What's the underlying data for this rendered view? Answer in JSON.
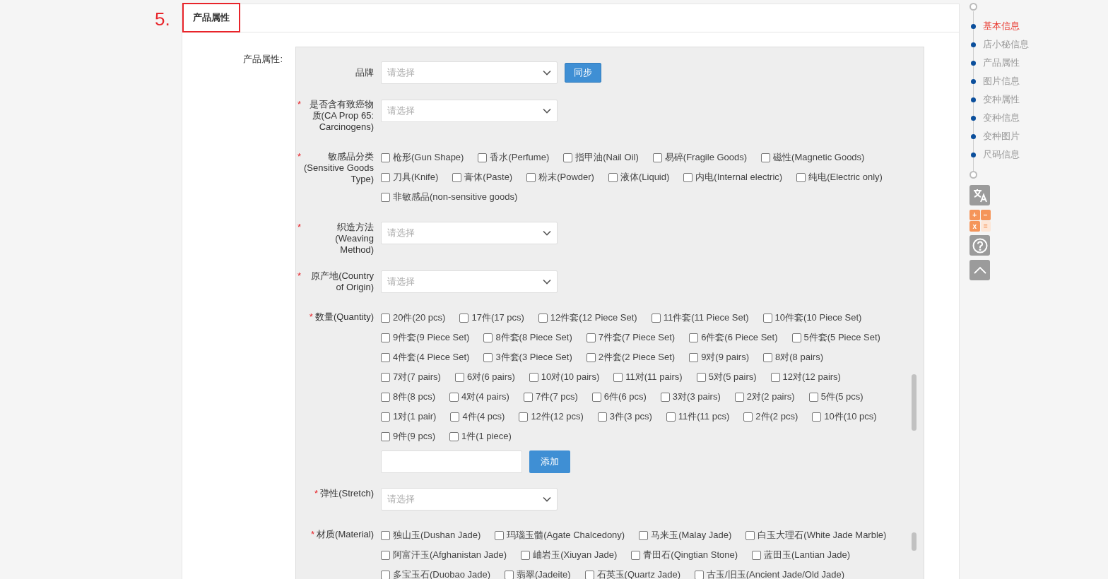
{
  "step_number": "5.",
  "section_tab": {
    "label": "产品属性",
    "selected": true
  },
  "attributes_label": "产品属性:",
  "fields": [
    {
      "kind": "select",
      "label": "品牌",
      "placeholder": "请选择",
      "button": "同步"
    },
    {
      "kind": "select",
      "label": "是否含有致癌物质(CA Prop 65: Carcinogens)",
      "required_mark": "*",
      "placeholder": "请选择"
    },
    {
      "kind": "checkboxes",
      "label": "敏感品分类(Sensitive Goods Type)",
      "required_mark": "*",
      "scrollbar": false,
      "options": [
        {
          "label": "枪形(Gun Shape)",
          "checked": false
        },
        {
          "label": "香水(Perfume)",
          "checked": false
        },
        {
          "label": "指甲油(Nail Oil)",
          "checked": false
        },
        {
          "label": "易碎(Fragile Goods)",
          "checked": false
        },
        {
          "label": "磁性(Magnetic Goods)",
          "checked": false
        },
        {
          "label": "刀具(Knife)",
          "checked": false
        },
        {
          "label": "膏体(Paste)",
          "checked": false
        },
        {
          "label": "粉末(Powder)",
          "checked": false
        },
        {
          "label": "液体(Liquid)",
          "checked": false
        },
        {
          "label": "内电(Internal electric)",
          "checked": false
        },
        {
          "label": "纯电(Electric only)",
          "checked": false
        },
        {
          "label": "非敏感品(non-sensitive goods)",
          "checked": false
        }
      ]
    },
    {
      "kind": "select",
      "label": "织造方法(Weaving Method)",
      "required_mark": "*",
      "placeholder": "请选择"
    },
    {
      "kind": "select",
      "label": "原产地(Country of Origin)",
      "required_mark": "*",
      "placeholder": "请选择"
    },
    {
      "kind": "checkboxes",
      "label": "数量(Quantity)",
      "required_mark": "*",
      "scrollbar": true,
      "add_button": "添加",
      "options": [
        {
          "label": "20件(20 pcs)",
          "checked": false
        },
        {
          "label": "17件(17 pcs)",
          "checked": false
        },
        {
          "label": "12件套(12 Piece Set)",
          "checked": false
        },
        {
          "label": "11件套(11 Piece Set)",
          "checked": false
        },
        {
          "label": "10件套(10 Piece Set)",
          "checked": false
        },
        {
          "label": "9件套(9 Piece Set)",
          "checked": false
        },
        {
          "label": "8件套(8 Piece Set)",
          "checked": false
        },
        {
          "label": "7件套(7 Piece Set)",
          "checked": false
        },
        {
          "label": "6件套(6 Piece Set)",
          "checked": false
        },
        {
          "label": "5件套(5 Piece Set)",
          "checked": false
        },
        {
          "label": "4件套(4 Piece Set)",
          "checked": false
        },
        {
          "label": "3件套(3 Piece Set)",
          "checked": false
        },
        {
          "label": "2件套(2 Piece Set)",
          "checked": false
        },
        {
          "label": "9对(9 pairs)",
          "checked": false
        },
        {
          "label": "8对(8 pairs)",
          "checked": false
        },
        {
          "label": "7对(7 pairs)",
          "checked": false
        },
        {
          "label": "6对(6 pairs)",
          "checked": false
        },
        {
          "label": "10对(10 pairs)",
          "checked": false
        },
        {
          "label": "11对(11 pairs)",
          "checked": false
        },
        {
          "label": "5对(5 pairs)",
          "checked": false
        },
        {
          "label": "12对(12 pairs)",
          "checked": false
        },
        {
          "label": "8件(8 pcs)",
          "checked": false
        },
        {
          "label": "4对(4 pairs)",
          "checked": false
        },
        {
          "label": "7件(7 pcs)",
          "checked": false
        },
        {
          "label": "6件(6 pcs)",
          "checked": false
        },
        {
          "label": "3对(3 pairs)",
          "checked": false
        },
        {
          "label": "2对(2 pairs)",
          "checked": false
        },
        {
          "label": "5件(5 pcs)",
          "checked": false
        },
        {
          "label": "1对(1 pair)",
          "checked": false
        },
        {
          "label": "4件(4 pcs)",
          "checked": false
        },
        {
          "label": "12件(12 pcs)",
          "checked": false
        },
        {
          "label": "3件(3 pcs)",
          "checked": false
        },
        {
          "label": "11件(11 pcs)",
          "checked": false
        },
        {
          "label": "2件(2 pcs)",
          "checked": false
        },
        {
          "label": "10件(10 pcs)",
          "checked": false
        },
        {
          "label": "9件(9 pcs)",
          "checked": false
        },
        {
          "label": "1件(1 piece)",
          "checked": false
        }
      ]
    },
    {
      "kind": "select",
      "label": "弹性(Stretch)",
      "required_mark": "*",
      "placeholder": "请选择"
    },
    {
      "kind": "checkboxes",
      "label": "材质(Material)",
      "required_mark": "*",
      "scrollbar": true,
      "options": [
        {
          "label": "独山玉(Dushan Jade)",
          "checked": false
        },
        {
          "label": "玛瑙玉髓(Agate Chalcedony)",
          "checked": false
        },
        {
          "label": "马来玉(Malay Jade)",
          "checked": false
        },
        {
          "label": "白玉大理石(White Jade Marble)",
          "checked": false
        },
        {
          "label": "阿富汗玉(Afghanistan Jade)",
          "checked": false
        },
        {
          "label": "岫岩玉(Xiuyan Jade)",
          "checked": false
        },
        {
          "label": "青田石(Qingtian Stone)",
          "checked": false
        },
        {
          "label": "蓝田玉(Lantian Jade)",
          "checked": false
        },
        {
          "label": "多宝玉石(Duobao Jade)",
          "checked": false
        },
        {
          "label": "翡翠(Jadeite)",
          "checked": false
        },
        {
          "label": "石英玉(Quartz Jade)",
          "checked": false
        },
        {
          "label": "古玉/旧玉(Ancient Jade/Old Jade)",
          "checked": false
        }
      ]
    }
  ],
  "side_nav": [
    {
      "label": "基本信息",
      "selected": true
    },
    {
      "label": "店小秘信息",
      "selected": false
    },
    {
      "label": "产品属性",
      "selected": false
    },
    {
      "label": "图片信息",
      "selected": false
    },
    {
      "label": "变种属性",
      "selected": false
    },
    {
      "label": "变种信息",
      "selected": false
    },
    {
      "label": "变种图片",
      "selected": false
    },
    {
      "label": "尺码信息",
      "selected": false
    }
  ],
  "calculator_keys": [
    "+",
    "−",
    "x",
    "="
  ]
}
